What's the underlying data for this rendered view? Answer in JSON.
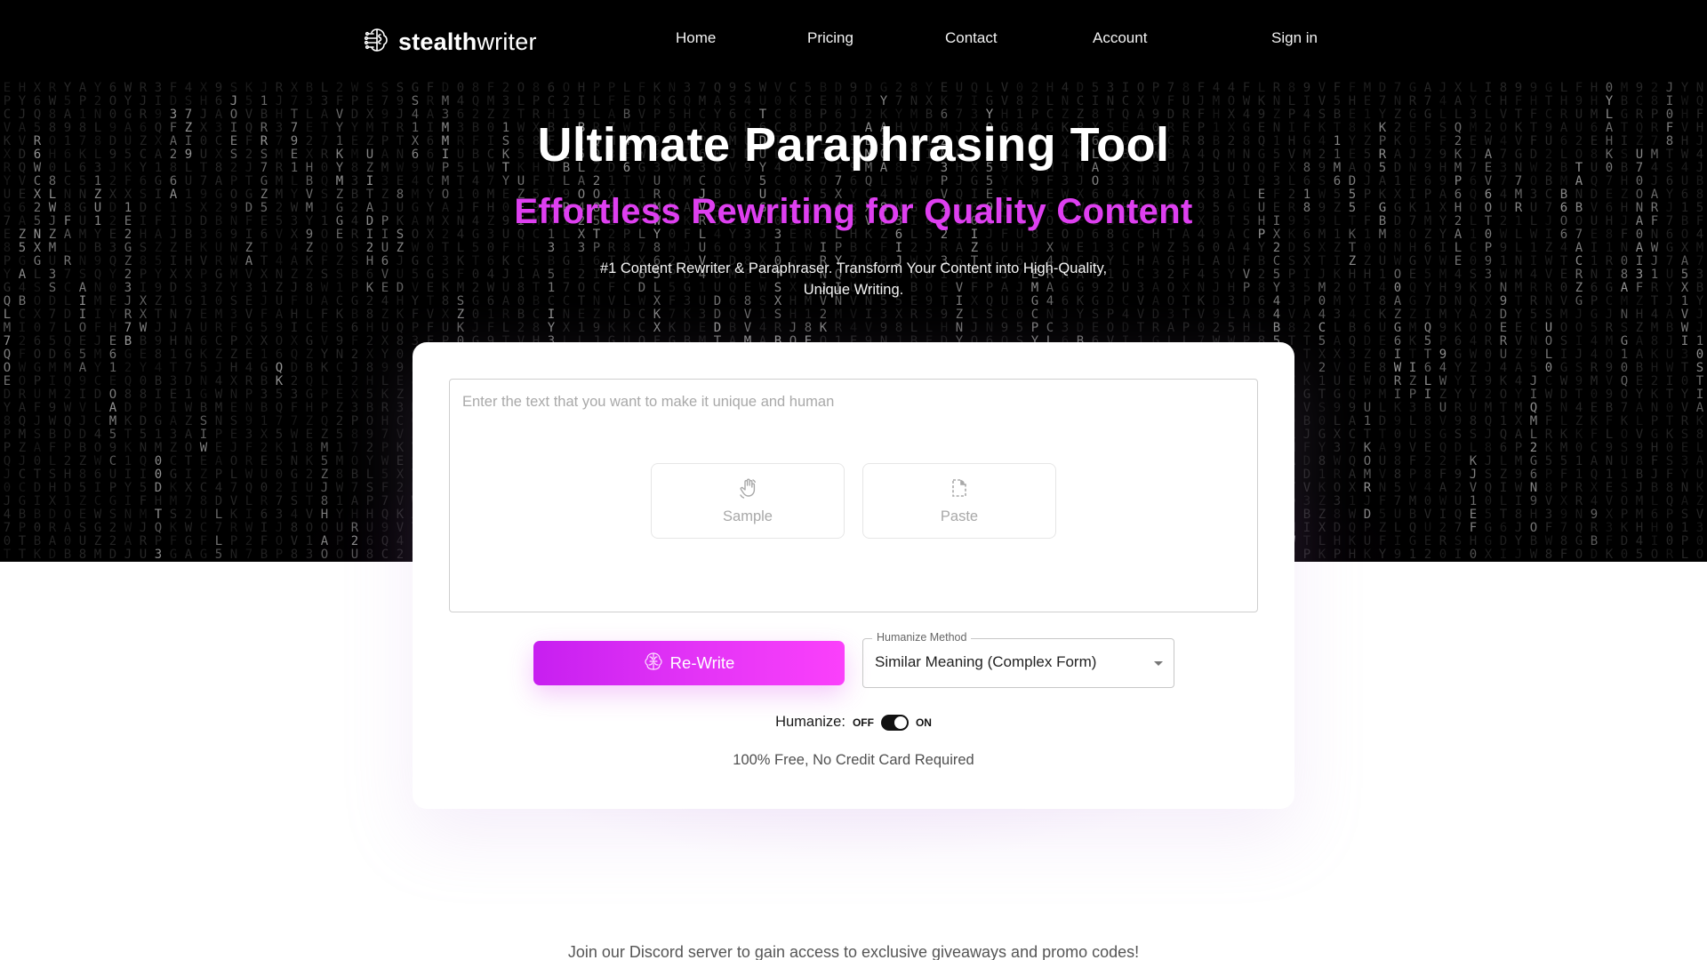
{
  "brand": {
    "name_bold": "stealth",
    "name_light": "writer",
    "logo_icon": "brain-circuit-icon"
  },
  "nav": {
    "items": [
      {
        "label": "Home"
      },
      {
        "label": "Pricing"
      },
      {
        "label": "Contact"
      },
      {
        "label": "Account"
      },
      {
        "label": "Sign in"
      }
    ]
  },
  "hero": {
    "title": "Ultimate Paraphrasing Tool",
    "subtitle": "Effortless Rewriting for Quality Content",
    "tagline": "#1 Content Rewriter & Paraphraser. Transform Your Content into High-Quality, Unique Writing.",
    "accent_color": "#de3ff0"
  },
  "editor": {
    "placeholder": "Enter the text that you want to make it unique and human",
    "value": "",
    "sample_label": "Sample",
    "sample_icon": "waving-hand-icon",
    "paste_label": "Paste",
    "paste_icon": "paste-document-icon"
  },
  "controls": {
    "rewrite_label": "Re-Write",
    "rewrite_icon": "brain-icon",
    "method_label": "Humanize Method",
    "method_value": "Similar Meaning (Complex Form)",
    "humanize_label": "Humanize:",
    "toggle_off": "OFF",
    "toggle_on": "ON",
    "humanize_state": "on",
    "free_note": "100% Free, No Credit Card Required",
    "button_gradient": [
      "#c71ff0",
      "#fb40fb"
    ]
  },
  "footer": {
    "discord_text": "Join our Discord server to gain access to exclusive giveaways and promo codes!"
  }
}
